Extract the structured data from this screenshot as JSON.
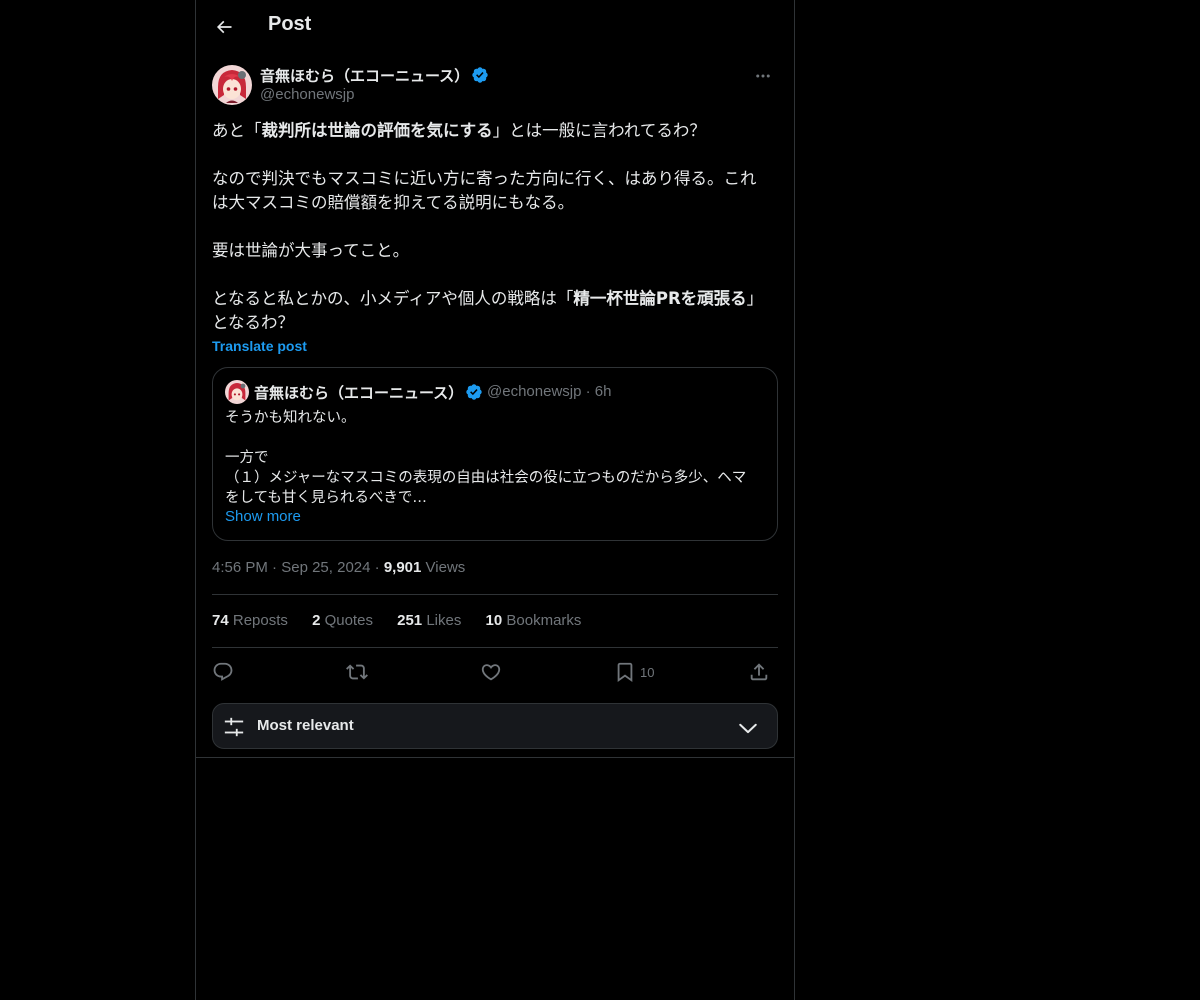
{
  "header": {
    "title": "Post"
  },
  "post": {
    "author": {
      "name": "音無ほむら（エコーニュース）",
      "handle": "@echonewsjp"
    },
    "text": {
      "p1_before": "あと「",
      "p1_bold": "裁判所は世論の評価を気にする",
      "p1_after": "」とは一般に言われてるわ？",
      "p2_line1": "なので判決でもマスコミに近い方に寄った方向に行く、はあり得る。これ",
      "p2_line2": "は大マスコミの賠償額を抑えてる説明にもなる。",
      "p3": "要は世論が大事ってこと。",
      "p4_before": "となると私とかの、小メディアや個人の戦略は「",
      "p4_bold": "精一杯世論PRを頑張る",
      "p4_after": "」",
      "p4_line2": "となるわ？"
    },
    "translate_label": "Translate post",
    "timestamp_time": "4:56 PM",
    "timestamp_date": "Sep 25, 2024",
    "views_count": "9,901",
    "views_label": "Views",
    "separator": "·"
  },
  "quote": {
    "author": {
      "name": "音無ほむら（エコーニュース）",
      "handle": "@echonewsjp"
    },
    "age": "6h",
    "separator": "·",
    "line1": "そうかも知れない。",
    "line2": "一方で",
    "line3": "（１）メジャーなマスコミの表現の自由は社会の役に立つものだから多少、ヘマ",
    "line4": "をしても甘く見られるべきで…",
    "show_more": "Show more"
  },
  "stats": {
    "reposts": {
      "count": "74",
      "label": "Reposts"
    },
    "quotes": {
      "count": "2",
      "label": "Quotes"
    },
    "likes": {
      "count": "251",
      "label": "Likes"
    },
    "bookmarks": {
      "count": "10",
      "label": "Bookmarks"
    }
  },
  "actions": {
    "reply": {
      "icon": "reply-icon"
    },
    "repost": {
      "icon": "repost-icon"
    },
    "like": {
      "icon": "heart-icon"
    },
    "bookmark": {
      "icon": "bookmark-icon",
      "count": "10"
    },
    "share": {
      "icon": "share-icon"
    }
  },
  "sort": {
    "label": "Most relevant",
    "icon": "sliders-icon",
    "chevron": "chevron-down-icon"
  },
  "colors": {
    "background": "#000000",
    "text": "#e7e9ea",
    "secondary": "#71767b",
    "accent": "#1d9bf0",
    "border": "#2f3336",
    "verified": "#1d9bf0"
  }
}
